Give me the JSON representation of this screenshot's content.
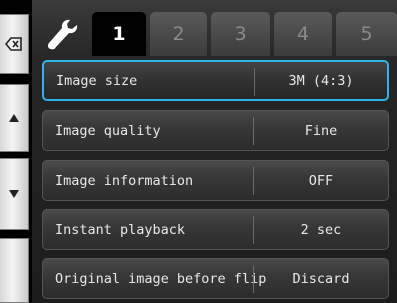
{
  "rail": {
    "buttons": [
      {
        "name": "back",
        "icon": "backspace-icon"
      },
      {
        "name": "up",
        "icon": "up-arrow-icon"
      },
      {
        "name": "down",
        "icon": "down-arrow-icon"
      },
      {
        "name": "blank",
        "icon": ""
      }
    ]
  },
  "tabs": {
    "setup_icon": "wrench-icon",
    "items": [
      {
        "label": "1",
        "active": true
      },
      {
        "label": "2",
        "active": false
      },
      {
        "label": "3",
        "active": false
      },
      {
        "label": "4",
        "active": false
      },
      {
        "label": "5",
        "active": false
      }
    ]
  },
  "settings": [
    {
      "label": "Image size",
      "value": "3M (4:3)",
      "selected": true
    },
    {
      "label": "Image quality",
      "value": "Fine",
      "selected": false
    },
    {
      "label": "Image information",
      "value": "OFF",
      "selected": false
    },
    {
      "label": "Instant playback",
      "value": "2 sec",
      "selected": false
    },
    {
      "label": "Original image before flip",
      "value": "Discard",
      "selected": false
    }
  ],
  "colors": {
    "selection": "#2fb4ea",
    "text": "#e8e8e8",
    "inactive_tab_text": "#8a8a8a"
  }
}
